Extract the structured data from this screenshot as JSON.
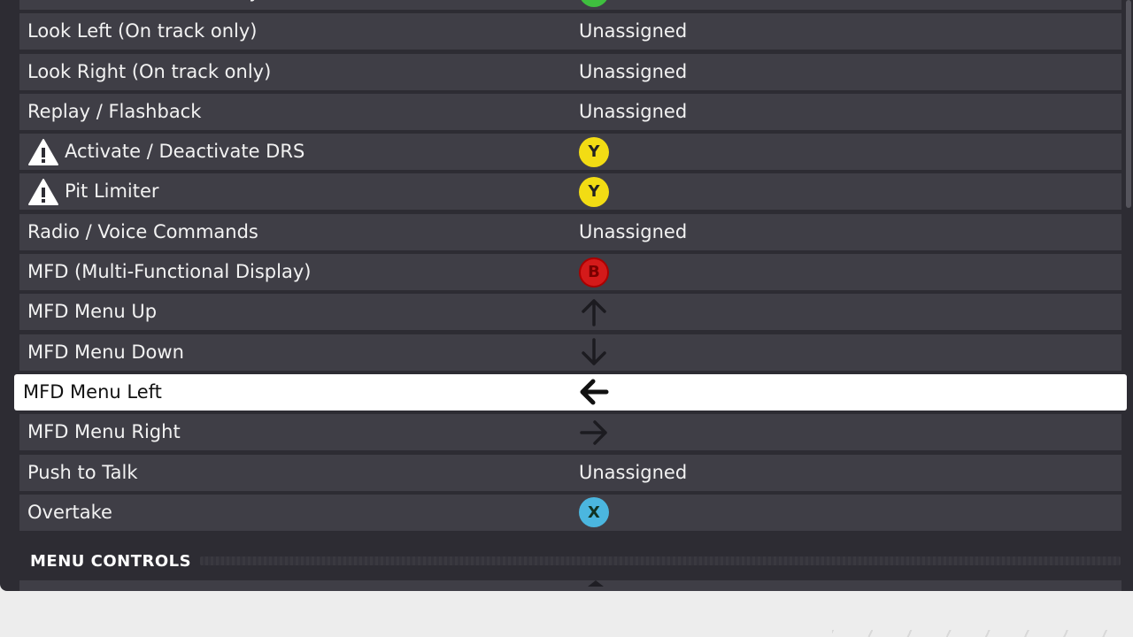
{
  "panel": {
    "rows": [
      {
        "label": "Look Back (On track only)",
        "binding": {
          "kind": "button",
          "glyph": "A",
          "color": "#3fbf3f"
        }
      },
      {
        "label": "Look Left (On track only)",
        "binding": {
          "kind": "text",
          "text": "Unassigned"
        }
      },
      {
        "label": "Look Right (On track only)",
        "binding": {
          "kind": "text",
          "text": "Unassigned"
        }
      },
      {
        "label": "Replay / Flashback",
        "binding": {
          "kind": "text",
          "text": "Unassigned"
        }
      },
      {
        "label": "Activate / Deactivate DRS",
        "warning": true,
        "binding": {
          "kind": "button",
          "glyph": "Y",
          "color": "#f2dc14"
        }
      },
      {
        "label": "Pit Limiter",
        "warning": true,
        "binding": {
          "kind": "button",
          "glyph": "Y",
          "color": "#f2dc14"
        }
      },
      {
        "label": "Radio / Voice Commands",
        "binding": {
          "kind": "text",
          "text": "Unassigned"
        }
      },
      {
        "label": "MFD (Multi-Functional Display)",
        "binding": {
          "kind": "button",
          "glyph": "B",
          "color": "#d41a1a"
        }
      },
      {
        "label": "MFD Menu Up",
        "binding": {
          "kind": "arrow",
          "icon": "arrow-up-icon"
        }
      },
      {
        "label": "MFD Menu Down",
        "binding": {
          "kind": "arrow",
          "icon": "arrow-down-icon"
        }
      },
      {
        "label": "MFD Menu Left",
        "selected": true,
        "binding": {
          "kind": "arrow",
          "icon": "arrow-left-icon"
        }
      },
      {
        "label": "MFD Menu Right",
        "binding": {
          "kind": "arrow",
          "icon": "arrow-right-icon"
        }
      },
      {
        "label": "Push to Talk",
        "binding": {
          "kind": "text",
          "text": "Unassigned"
        }
      },
      {
        "label": "Overtake",
        "binding": {
          "kind": "button",
          "glyph": "X",
          "color": "#4bb6df"
        }
      }
    ],
    "section_title": "MENU CONTROLS"
  },
  "colors": {
    "row_bg": "#3f3e46",
    "panel_bg": "#2d2c33",
    "selected_bg": "#ffffff"
  }
}
